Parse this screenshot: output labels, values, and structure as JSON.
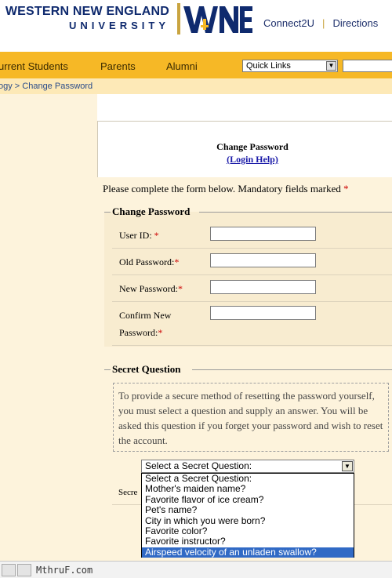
{
  "header": {
    "logo_line1": "WESTERN NEW ENGLAND",
    "logo_line2": "UNIVERSITY",
    "logo_mark": "WNE",
    "links": [
      "Connect2U",
      "Directions"
    ]
  },
  "nav": {
    "items": [
      "urrent Students",
      "Parents",
      "Alumni"
    ],
    "quick_links": "Quick Links"
  },
  "breadcrumb": "ogy > Change Password",
  "form": {
    "title": "Change Password",
    "login_help": "(Login Help)",
    "intro": "Please complete the form below. Mandatory fields marked",
    "required_mark": "*",
    "change_password_legend": "Change Password",
    "fields": {
      "user_id": "User ID:",
      "old_password": "Old Password:",
      "new_password": "New Password:",
      "confirm_new": "Confirm New",
      "confirm_password": "Password:"
    },
    "secret_question_legend": "Secret Question",
    "secret_info": "To provide a secure method of resetting the password yourself, you must select a question and supply an answer. You will be asked this question if you forget your password and wish to reset the account.",
    "partial_label": "Secre",
    "select_value": "Select a Secret Question:",
    "options": [
      "Select a Secret Question:",
      "Mother's maiden name?",
      "Favorite flavor of ice cream?",
      "Pet's name?",
      "City in which you were born?",
      "Favorite color?",
      "Favorite instructor?",
      "Airspeed velocity of an unladen swallow?"
    ],
    "selected_option_index": 7
  },
  "watermark": "MthruF.com",
  "colors": {
    "brand_navy": "#0f2a6e",
    "nav_orange": "#f6b826",
    "panel_bg": "#fdf3dc",
    "required_red": "#cc0000",
    "selection_blue": "#316ac5"
  }
}
